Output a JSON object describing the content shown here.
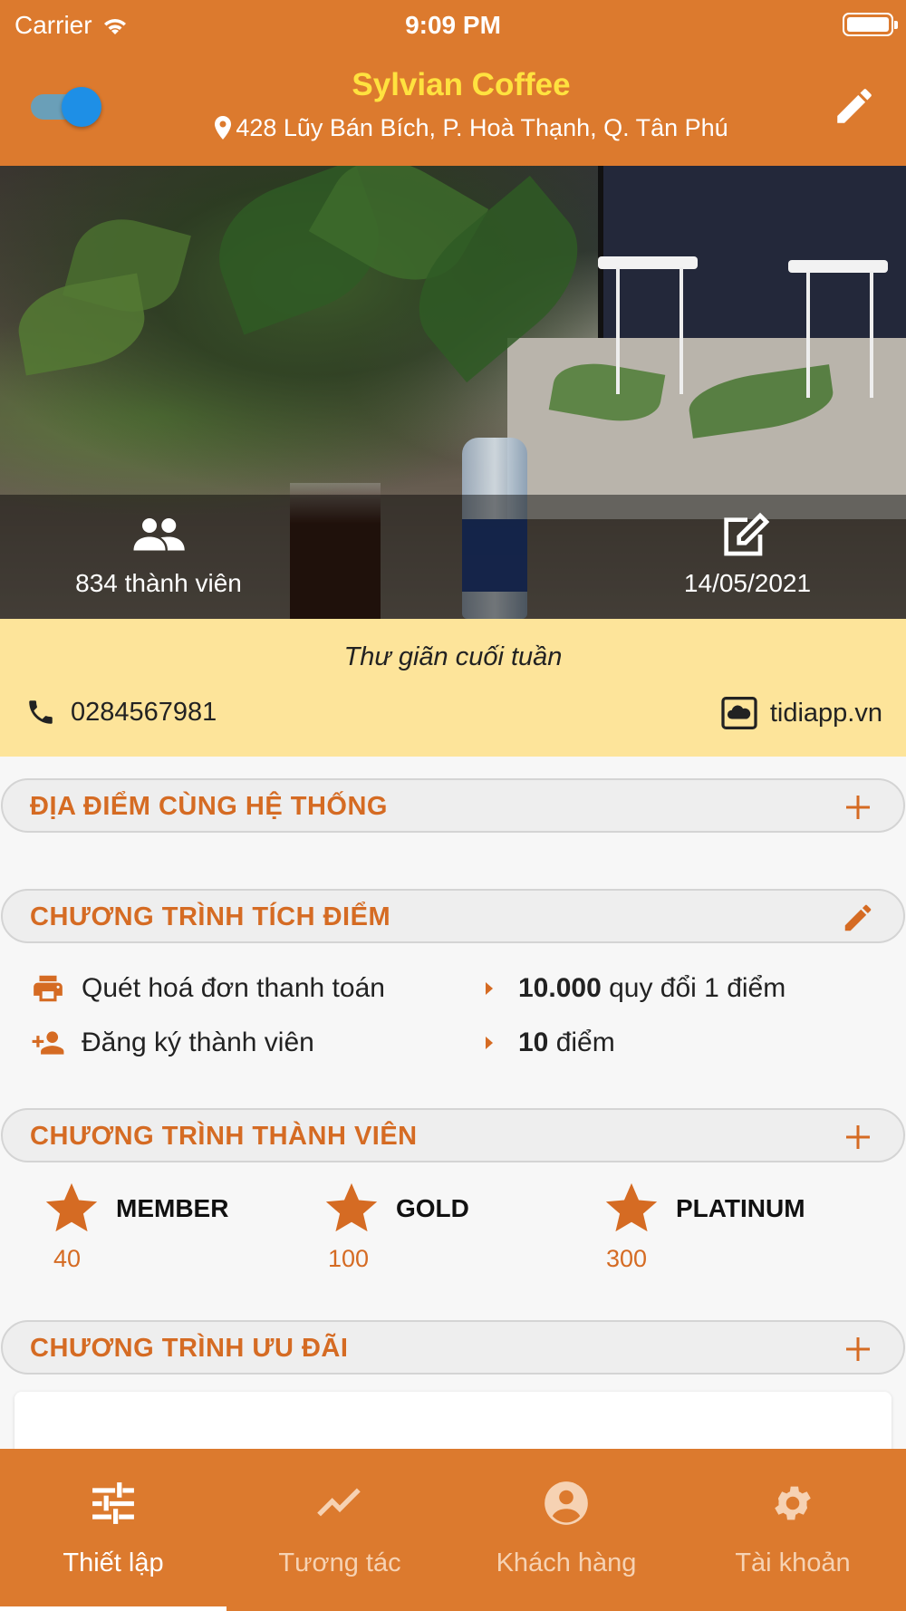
{
  "status_bar": {
    "carrier": "Carrier",
    "time": "9:09 PM"
  },
  "header": {
    "title": "Sylvian Coffee",
    "address": "428 Lũy Bán Bích, P. Hoà Thạnh, Q. Tân Phú",
    "toggle_on": true
  },
  "hero": {
    "members": "834 thành viên",
    "date": "14/05/2021"
  },
  "info": {
    "tagline": "Thư giãn cuối tuần",
    "phone": "0284567981",
    "website": "tidiapp.vn"
  },
  "sections": {
    "locations": "ĐỊA ĐIỂM CÙNG HỆ THỐNG",
    "loyalty": "CHƯƠNG TRÌNH TÍCH ĐIỂM",
    "membership": "CHƯƠNG TRÌNH THÀNH VIÊN",
    "offers": "CHƯƠNG TRÌNH ƯU ĐÃI"
  },
  "loyalty_rules": [
    {
      "label": "Quét hoá đơn thanh toán",
      "value_bold": "10.000",
      "value_rest": " quy đổi 1 điểm",
      "icon": "printer-icon"
    },
    {
      "label": "Đăng ký thành viên",
      "value_bold": "10",
      "value_rest": " điểm",
      "icon": "add-person-icon"
    }
  ],
  "tiers": [
    {
      "name": "MEMBER",
      "points": "40"
    },
    {
      "name": "GOLD",
      "points": "100"
    },
    {
      "name": "PLATINUM",
      "points": "300"
    }
  ],
  "tabs": [
    {
      "label": "Thiết lập",
      "icon": "sliders-icon",
      "active": true
    },
    {
      "label": "Tương tác",
      "icon": "trend-icon",
      "active": false
    },
    {
      "label": "Khách hàng",
      "icon": "account-icon",
      "active": false
    },
    {
      "label": "Tài khoản",
      "icon": "gear-icon",
      "active": false
    }
  ],
  "colors": {
    "brand": "#dc7a2e",
    "title_yellow": "#ffe23f",
    "section_text": "#d56b23",
    "info_band": "#fde49a",
    "toggle": "#1e8fe6"
  }
}
